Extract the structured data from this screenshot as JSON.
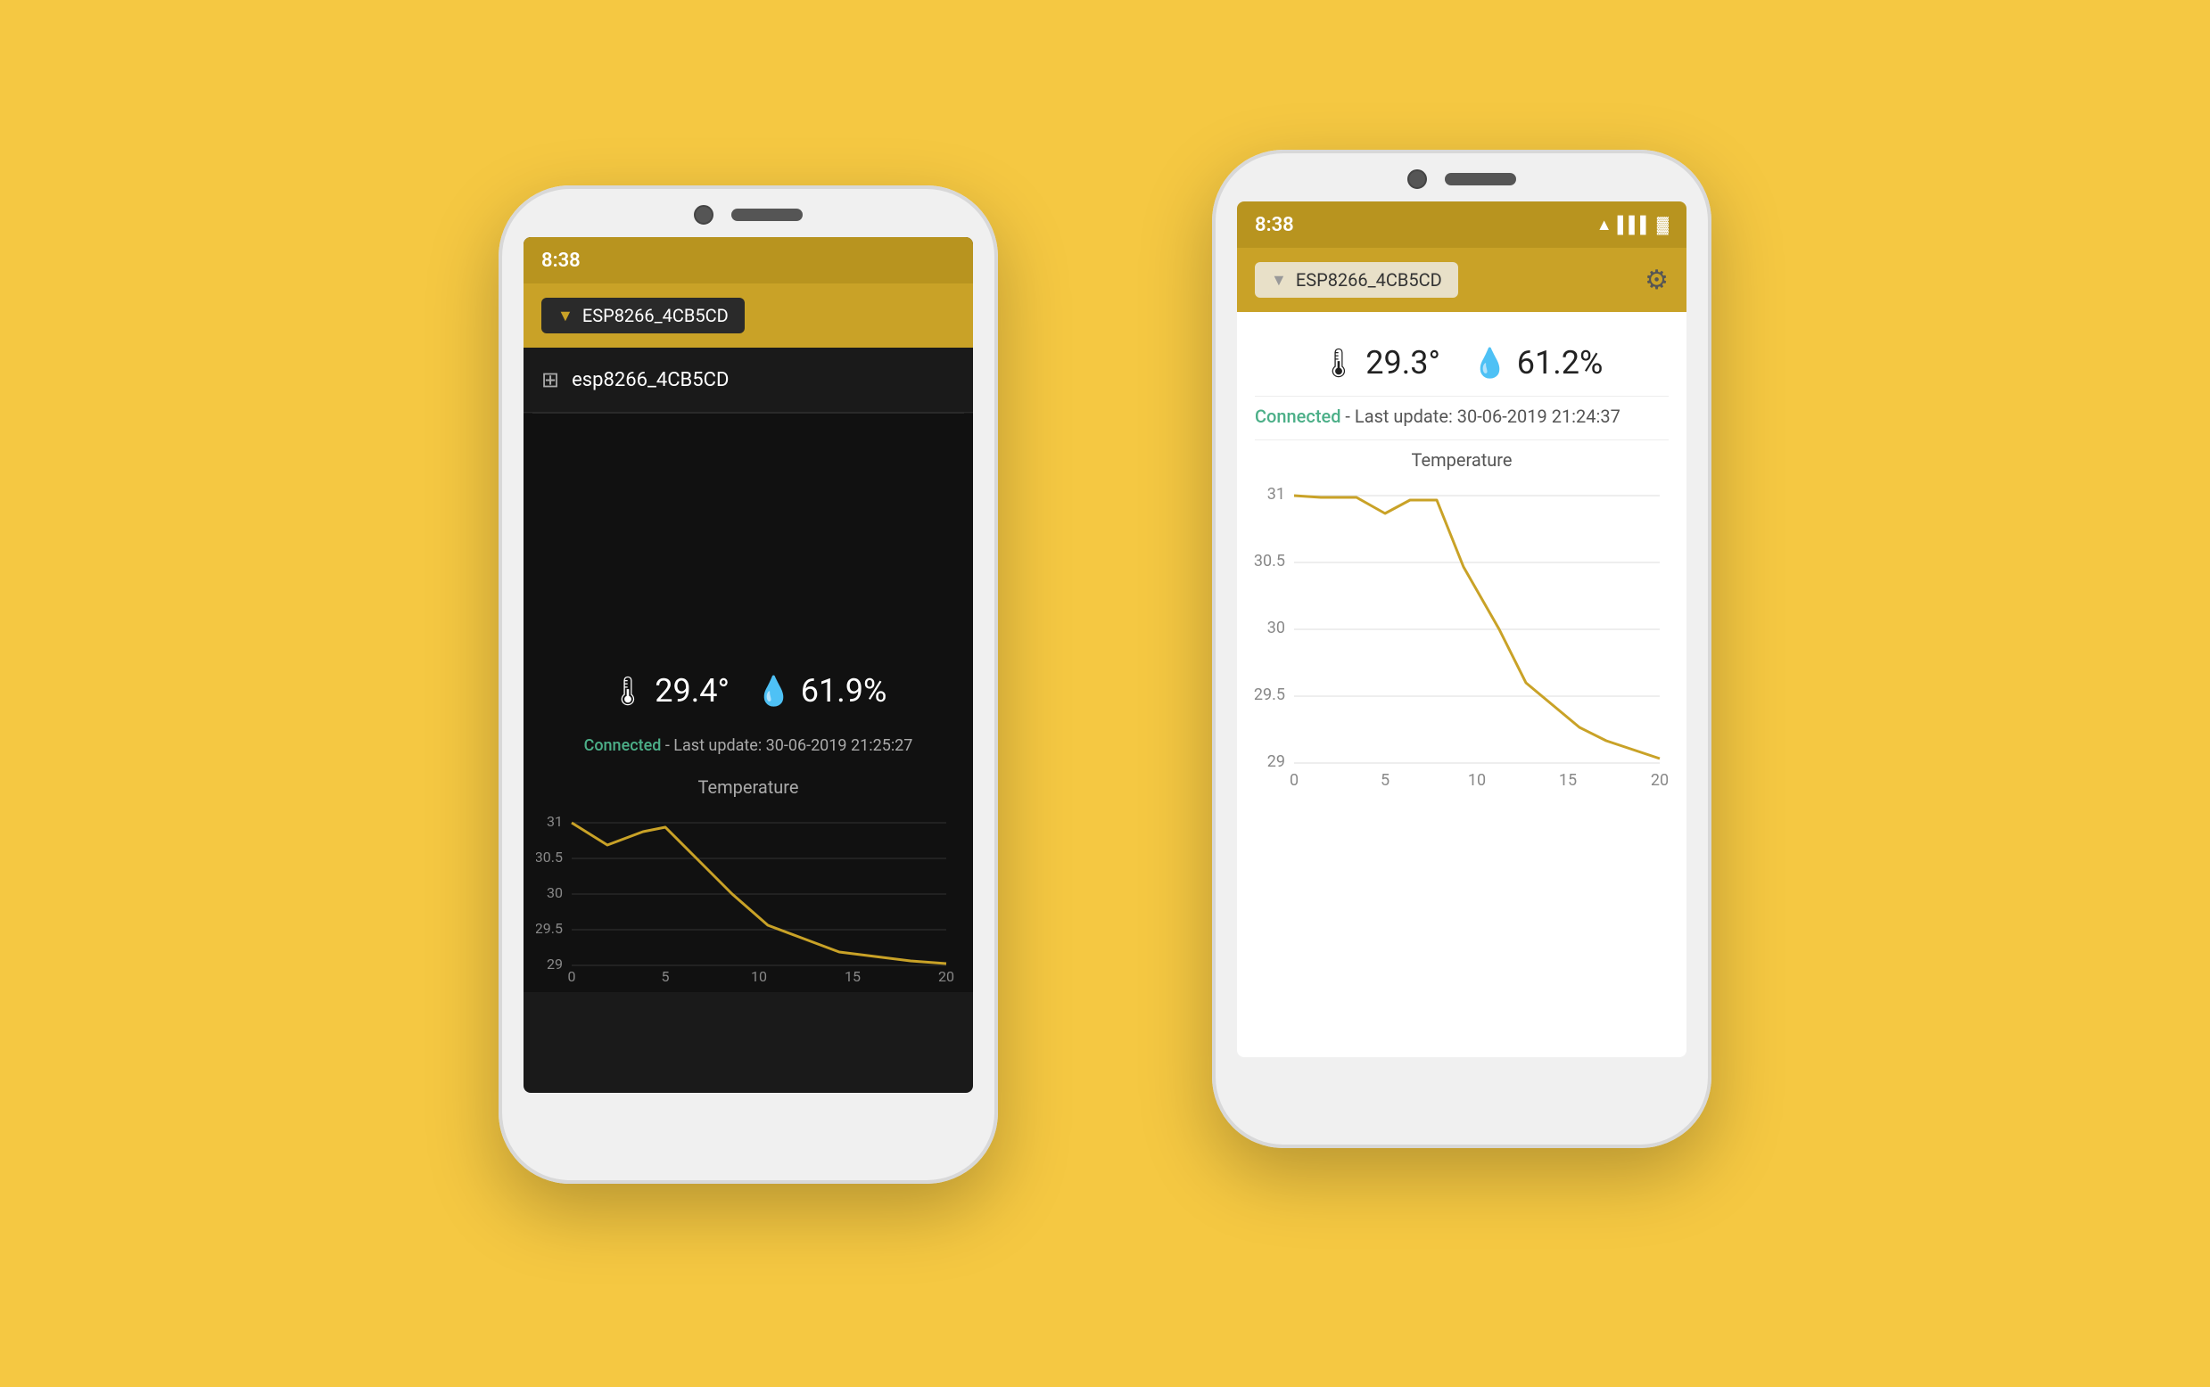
{
  "background": "#F5C842",
  "phone_left": {
    "time": "8:38",
    "app_bar": {
      "device_name": "ESP8266_4CB5CD"
    },
    "device_list": {
      "items": [
        {
          "label": "esp8266_4CB5CD",
          "icon": "chip"
        }
      ]
    },
    "sensor": {
      "temperature": "29.4°",
      "humidity": "61.9%"
    },
    "status": {
      "connected_label": "Connected",
      "last_update_text": " - Last update: 30-06-2019 21:25:27"
    },
    "chart": {
      "title": "Temperature",
      "x_labels": [
        "0",
        "5",
        "10",
        "15",
        "20"
      ],
      "y_labels": [
        "29",
        "29.5",
        "30",
        "30.5",
        "31"
      ],
      "accent_color": "#C9A227"
    }
  },
  "phone_right": {
    "time": "8:38",
    "app_bar": {
      "device_name": "ESP8266_4CB5CD"
    },
    "sensor": {
      "temperature": "29.3°",
      "humidity": "61.2%"
    },
    "status": {
      "connected_label": "Connected",
      "last_update_text": " - Last update: 30-06-2019 21:24:37"
    },
    "chart": {
      "title": "Temperature",
      "x_labels": [
        "0",
        "5",
        "10",
        "15",
        "20"
      ],
      "y_labels": [
        "29",
        "29.5",
        "30",
        "30.5",
        "31"
      ],
      "accent_color": "#C9A227"
    }
  },
  "icons": {
    "thermometer": "🌡",
    "droplet": "💧",
    "chip": "🖥",
    "gear": "⚙",
    "wifi": "▲",
    "signal": "▌",
    "battery": "▓"
  }
}
